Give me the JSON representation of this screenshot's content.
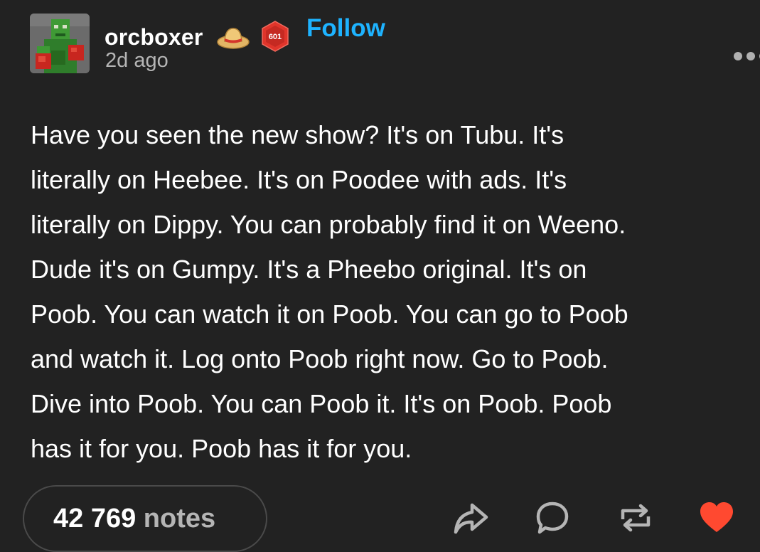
{
  "post": {
    "author": {
      "username": "orcboxer",
      "badge_text": "601",
      "follow_label": "Follow",
      "timestamp": "2d ago"
    },
    "body_lines": [
      "Have you seen the new show? It's on Tubu. It's",
      "literally on Heebee. It's on Poodee with ads. It's",
      "literally on Dippy. You can probably find it on Weeno.",
      "Dude it's on Gumpy. It's a Pheebo original. It's on",
      "Poob. You can watch it on Poob. You can go to Poob",
      "and watch it. Log onto Poob right now. Go to Poob.",
      "Dive into Poob. You can Poob it. It's on Poob. Poob",
      "has it for you. Poob has it for you."
    ],
    "notes": {
      "count": "42 769",
      "label": "notes"
    },
    "actions": [
      {
        "name": "share-icon"
      },
      {
        "name": "reply-icon"
      },
      {
        "name": "reblog-icon"
      },
      {
        "name": "heart-icon"
      }
    ]
  },
  "colors": {
    "background": "#222222",
    "follow": "#1eb3ff",
    "muted_text": "#b5b5b5",
    "heart": "#ff4930",
    "badge": "#e0352b"
  }
}
